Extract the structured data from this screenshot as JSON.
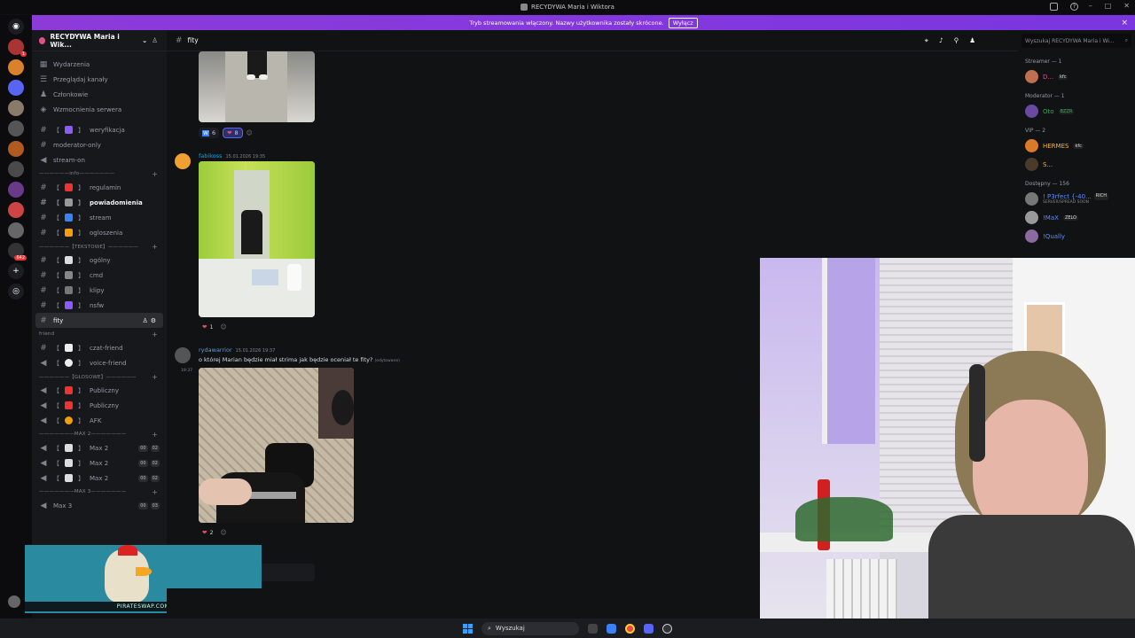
{
  "window": {
    "title": "RECYDYWA Maria i Wiktora"
  },
  "banner": {
    "text": "Tryb streamowania włączony. Nazwy użytkownika zostały skrócone.",
    "button": "Wyłącz",
    "close": "×"
  },
  "guild": {
    "name": "RECYDYWA Maria i Wik...",
    "chevron": "⌄"
  },
  "sidebar": {
    "top_items": [
      {
        "label": "Wydarzenia",
        "icon": "calendar-icon"
      },
      {
        "label": "Przeglądaj kanały",
        "icon": "browse-icon"
      },
      {
        "label": "Członkowie",
        "icon": "members-icon"
      },
      {
        "label": "Wzmocnienia serwera",
        "icon": "boost-icon"
      }
    ],
    "channels_a": [
      {
        "label": "weryfikacja",
        "tag": "【",
        "emoji_color": "#8b5cf6"
      },
      {
        "label": "moderator-only"
      },
      {
        "label": "stream-on"
      }
    ],
    "cat_info": "——————info———————",
    "channels_info": [
      {
        "label": "regulamin",
        "emoji_color": "#e33"
      },
      {
        "label": "powiadomienia",
        "emoji_color": "#999",
        "bold": true
      },
      {
        "label": "stream",
        "emoji_color": "#3b82f6"
      },
      {
        "label": "ogloszenia",
        "emoji_color": "#f59e0b"
      }
    ],
    "cat_text": "——————【TEKSTOWE】——————",
    "channels_text": [
      {
        "label": "ogólny"
      },
      {
        "label": "cmd"
      },
      {
        "label": "klipy"
      },
      {
        "label": "nsfw"
      },
      {
        "label": "fity"
      }
    ],
    "cat_friend": "friend",
    "channels_friend": [
      {
        "label": "czat-friend"
      },
      {
        "label": "voice-friend"
      }
    ],
    "cat_voice": "——————【GŁOSOWE】——————",
    "channels_voice": [
      {
        "label": "Publiczny"
      },
      {
        "label": "Publiczny"
      },
      {
        "label": "AFK"
      }
    ],
    "cat_max2": "———————MAX 2———————",
    "channels_max2": [
      {
        "label": "Max 2",
        "c1": "00",
        "c2": "02"
      },
      {
        "label": "Max 2",
        "c1": "00",
        "c2": "02"
      },
      {
        "label": "Max 2",
        "c1": "00",
        "c2": "02"
      }
    ],
    "cat_max3": "———————MAX 3———————",
    "channels_max3": [
      {
        "label": "Max 3",
        "c1": "00",
        "c2": "03"
      }
    ]
  },
  "channel": {
    "name": "fity",
    "search_placeholder": "Wyszukaj RECYDYWA Maria i Wi..."
  },
  "messages": [
    {
      "reactions": [
        {
          "emoji": "W",
          "count": "6"
        },
        {
          "emoji": "❤",
          "count": "8"
        }
      ]
    },
    {
      "user": "fabikoss",
      "time": "15.01.2026 19:35",
      "reactions": [
        {
          "emoji": "❤",
          "count": "1"
        }
      ]
    },
    {
      "user": "rydawarrior",
      "time": "15.01.2026 19:37",
      "side_time": "19:37",
      "text": "o której Marian będzie miał strima jak będzie oceniał te fity?",
      "edited": "(edytowane)",
      "reactions": [
        {
          "emoji": "❤",
          "count": "2"
        }
      ]
    }
  ],
  "members": {
    "groups": [
      {
        "label": "Streamer — 1",
        "members": [
          {
            "name": "D...",
            "color": "#e0508a",
            "tag": "kfc"
          }
        ]
      },
      {
        "label": "Moderator — 1",
        "members": [
          {
            "name": "Oto",
            "color": "#3ba55d",
            "tag": "BZZR"
          }
        ]
      },
      {
        "label": "VIP — 2",
        "members": [
          {
            "name": "HERMES",
            "color": "#f5b43c",
            "tag": "kfc"
          },
          {
            "name": "S...",
            "color": "#f5b43c",
            "tag": ""
          }
        ]
      },
      {
        "label": "Dostępny — 156",
        "members": [
          {
            "name": "! P3rfect {-40...",
            "color": "#5b8cff",
            "tag": "RICH",
            "sub": "SERVER/SPREAD SOON"
          },
          {
            "name": "!MaX",
            "color": "#5b8cff",
            "tag": "ZELO"
          },
          {
            "name": "!Qually",
            "color": "#5b8cff",
            "tag": ""
          }
        ]
      }
    ]
  },
  "overlay": {
    "label": "PIRATESWAP.COM"
  },
  "taskbar": {
    "search_placeholder": "Wyszukaj"
  }
}
